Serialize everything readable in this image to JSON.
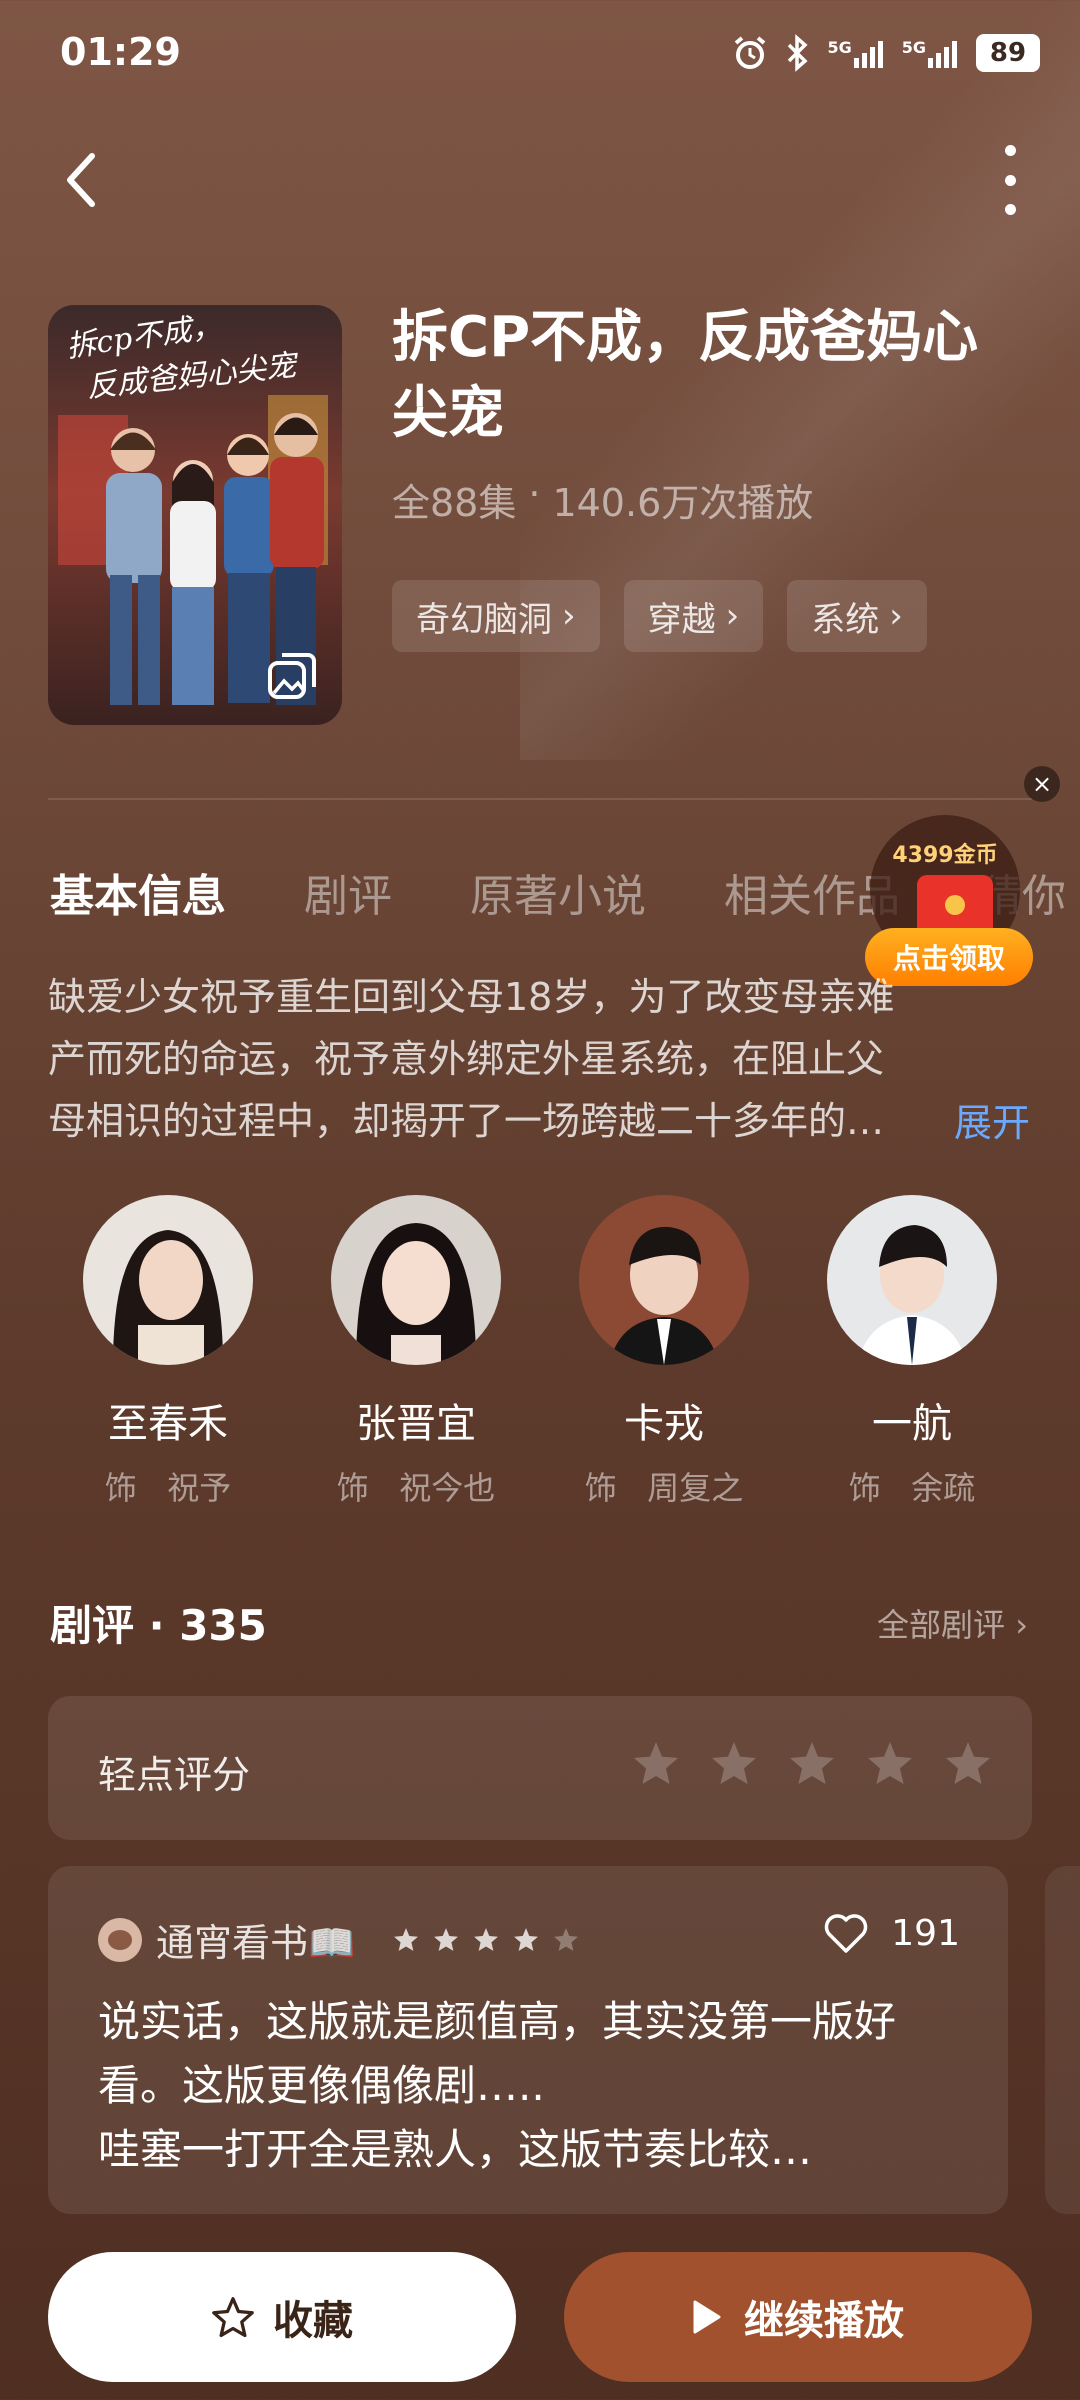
{
  "status_bar": {
    "time": "01:29",
    "network_1": "5G",
    "network_2": "5G",
    "battery": "89"
  },
  "nav": {
    "back_icon": "chevron-left-icon",
    "more_icon": "more-vertical-icon"
  },
  "drama": {
    "title": "拆CP不成，反成爸妈心尖宠",
    "episodes": "全88集",
    "separator": "·",
    "plays": "140.6万次播放",
    "tags": [
      "奇幻脑洞",
      "穿越",
      "系统"
    ],
    "poster_title": "拆cp不成，反成爸妈心尖宠"
  },
  "tabs": [
    "基本信息",
    "剧评",
    "原著小说",
    "相关作品",
    "猜你"
  ],
  "active_tab": "基本信息",
  "promo": {
    "coins": "4399金币",
    "button": "点击领取",
    "close": "×"
  },
  "synopsis": {
    "text": "缺爱少女祝予重生回到父母18岁，为了改变母亲难产而死的命运，祝予意外绑定外星系统，在阻止父母相识的过程中，却揭开了一场跨越二十多年的…",
    "expand": "展开"
  },
  "cast": [
    {
      "name": "至春禾",
      "role_prefix": "饰",
      "role": "祝予"
    },
    {
      "name": "张晋宜",
      "role_prefix": "饰",
      "role": "祝今也"
    },
    {
      "name": "卡戎",
      "role_prefix": "饰",
      "role": "周复之"
    },
    {
      "name": "一航",
      "role_prefix": "饰",
      "role": "余疏"
    }
  ],
  "reviews": {
    "title": "剧评 · 335",
    "view_all": "全部剧评 ›",
    "rate_label": "轻点评分",
    "rate_stars": 5,
    "review": {
      "user": "通宵看书📖",
      "stars": 4,
      "stars_max": 5,
      "likes": "191",
      "text_1": "说实话，这版就是颜值高，其实没第一版好看。这版更像偶像剧…..",
      "text_2": "哇塞一打开全是熟人，这版节奏比较…"
    }
  },
  "bottom": {
    "favorite": "收藏",
    "play": "继续播放"
  },
  "colors": {
    "accent_play": "#a1512e",
    "link": "#6aa9ff",
    "promo": "#ff8f10"
  }
}
